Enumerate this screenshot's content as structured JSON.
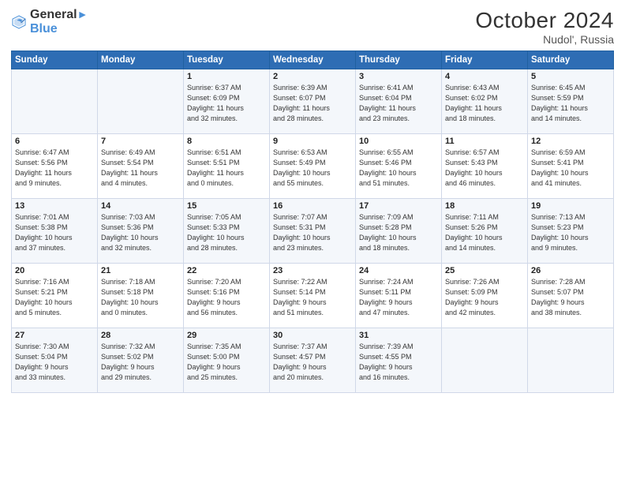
{
  "logo": {
    "general": "General",
    "blue": "Blue"
  },
  "title": "October 2024",
  "location": "Nudol', Russia",
  "days_header": [
    "Sunday",
    "Monday",
    "Tuesday",
    "Wednesday",
    "Thursday",
    "Friday",
    "Saturday"
  ],
  "weeks": [
    [
      {
        "day": "",
        "info": ""
      },
      {
        "day": "",
        "info": ""
      },
      {
        "day": "1",
        "info": "Sunrise: 6:37 AM\nSunset: 6:09 PM\nDaylight: 11 hours\nand 32 minutes."
      },
      {
        "day": "2",
        "info": "Sunrise: 6:39 AM\nSunset: 6:07 PM\nDaylight: 11 hours\nand 28 minutes."
      },
      {
        "day": "3",
        "info": "Sunrise: 6:41 AM\nSunset: 6:04 PM\nDaylight: 11 hours\nand 23 minutes."
      },
      {
        "day": "4",
        "info": "Sunrise: 6:43 AM\nSunset: 6:02 PM\nDaylight: 11 hours\nand 18 minutes."
      },
      {
        "day": "5",
        "info": "Sunrise: 6:45 AM\nSunset: 5:59 PM\nDaylight: 11 hours\nand 14 minutes."
      }
    ],
    [
      {
        "day": "6",
        "info": "Sunrise: 6:47 AM\nSunset: 5:56 PM\nDaylight: 11 hours\nand 9 minutes."
      },
      {
        "day": "7",
        "info": "Sunrise: 6:49 AM\nSunset: 5:54 PM\nDaylight: 11 hours\nand 4 minutes."
      },
      {
        "day": "8",
        "info": "Sunrise: 6:51 AM\nSunset: 5:51 PM\nDaylight: 11 hours\nand 0 minutes."
      },
      {
        "day": "9",
        "info": "Sunrise: 6:53 AM\nSunset: 5:49 PM\nDaylight: 10 hours\nand 55 minutes."
      },
      {
        "day": "10",
        "info": "Sunrise: 6:55 AM\nSunset: 5:46 PM\nDaylight: 10 hours\nand 51 minutes."
      },
      {
        "day": "11",
        "info": "Sunrise: 6:57 AM\nSunset: 5:43 PM\nDaylight: 10 hours\nand 46 minutes."
      },
      {
        "day": "12",
        "info": "Sunrise: 6:59 AM\nSunset: 5:41 PM\nDaylight: 10 hours\nand 41 minutes."
      }
    ],
    [
      {
        "day": "13",
        "info": "Sunrise: 7:01 AM\nSunset: 5:38 PM\nDaylight: 10 hours\nand 37 minutes."
      },
      {
        "day": "14",
        "info": "Sunrise: 7:03 AM\nSunset: 5:36 PM\nDaylight: 10 hours\nand 32 minutes."
      },
      {
        "day": "15",
        "info": "Sunrise: 7:05 AM\nSunset: 5:33 PM\nDaylight: 10 hours\nand 28 minutes."
      },
      {
        "day": "16",
        "info": "Sunrise: 7:07 AM\nSunset: 5:31 PM\nDaylight: 10 hours\nand 23 minutes."
      },
      {
        "day": "17",
        "info": "Sunrise: 7:09 AM\nSunset: 5:28 PM\nDaylight: 10 hours\nand 18 minutes."
      },
      {
        "day": "18",
        "info": "Sunrise: 7:11 AM\nSunset: 5:26 PM\nDaylight: 10 hours\nand 14 minutes."
      },
      {
        "day": "19",
        "info": "Sunrise: 7:13 AM\nSunset: 5:23 PM\nDaylight: 10 hours\nand 9 minutes."
      }
    ],
    [
      {
        "day": "20",
        "info": "Sunrise: 7:16 AM\nSunset: 5:21 PM\nDaylight: 10 hours\nand 5 minutes."
      },
      {
        "day": "21",
        "info": "Sunrise: 7:18 AM\nSunset: 5:18 PM\nDaylight: 10 hours\nand 0 minutes."
      },
      {
        "day": "22",
        "info": "Sunrise: 7:20 AM\nSunset: 5:16 PM\nDaylight: 9 hours\nand 56 minutes."
      },
      {
        "day": "23",
        "info": "Sunrise: 7:22 AM\nSunset: 5:14 PM\nDaylight: 9 hours\nand 51 minutes."
      },
      {
        "day": "24",
        "info": "Sunrise: 7:24 AM\nSunset: 5:11 PM\nDaylight: 9 hours\nand 47 minutes."
      },
      {
        "day": "25",
        "info": "Sunrise: 7:26 AM\nSunset: 5:09 PM\nDaylight: 9 hours\nand 42 minutes."
      },
      {
        "day": "26",
        "info": "Sunrise: 7:28 AM\nSunset: 5:07 PM\nDaylight: 9 hours\nand 38 minutes."
      }
    ],
    [
      {
        "day": "27",
        "info": "Sunrise: 7:30 AM\nSunset: 5:04 PM\nDaylight: 9 hours\nand 33 minutes."
      },
      {
        "day": "28",
        "info": "Sunrise: 7:32 AM\nSunset: 5:02 PM\nDaylight: 9 hours\nand 29 minutes."
      },
      {
        "day": "29",
        "info": "Sunrise: 7:35 AM\nSunset: 5:00 PM\nDaylight: 9 hours\nand 25 minutes."
      },
      {
        "day": "30",
        "info": "Sunrise: 7:37 AM\nSunset: 4:57 PM\nDaylight: 9 hours\nand 20 minutes."
      },
      {
        "day": "31",
        "info": "Sunrise: 7:39 AM\nSunset: 4:55 PM\nDaylight: 9 hours\nand 16 minutes."
      },
      {
        "day": "",
        "info": ""
      },
      {
        "day": "",
        "info": ""
      }
    ]
  ]
}
